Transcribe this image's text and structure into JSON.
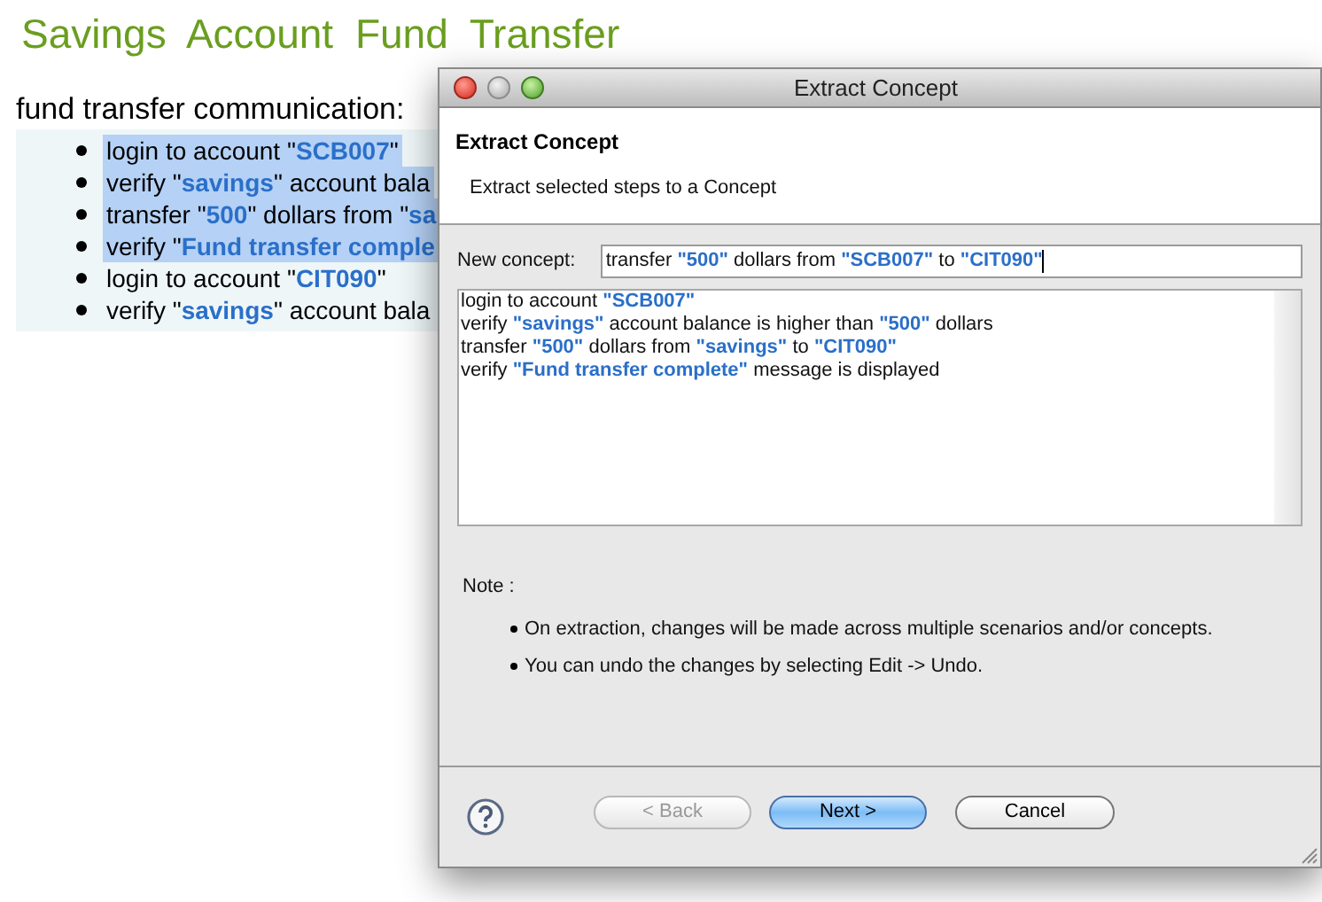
{
  "page": {
    "title": "Savings Account Fund Transfer",
    "section": "fund transfer communication:",
    "steps": [
      {
        "text": "login to account \"**SCB007**\"",
        "selected": true
      },
      {
        "text": "verify \"**savings**\" account bala",
        "selected": true
      },
      {
        "text": "transfer \"**500**\" dollars from \"**sa**",
        "selected": true
      },
      {
        "text": "verify \"**Fund transfer comple**",
        "selected": true
      },
      {
        "text": "login to account \"**CIT090**\"",
        "selected": false
      },
      {
        "text": "verify \"**savings**\" account bala",
        "selected": false
      }
    ]
  },
  "dialog": {
    "title": "Extract Concept",
    "heading": "Extract Concept",
    "description": "Extract selected steps to a Concept",
    "concept_label": "New concept:",
    "concept_value": "transfer **\"500\"** dollars from **\"SCB007\"** to **\"CIT090\"**",
    "steps": [
      "login to account **\"SCB007\"**",
      "verify **\"savings\"** account balance is higher than **\"500\"** dollars",
      "transfer **\"500\"** dollars from **\"savings\"** to **\"CIT090\"**",
      "verify **\"Fund transfer complete\"** message is displayed"
    ],
    "note_label": "Note :",
    "notes": [
      "On extraction, changes will be made across multiple scenarios and/or concepts.",
      "You can undo the changes by selecting Edit -> Undo."
    ],
    "buttons": [
      {
        "label": "< Back",
        "disabled": true,
        "default": false
      },
      {
        "label": "Next >",
        "disabled": false,
        "default": true
      },
      {
        "label": "Cancel",
        "disabled": false,
        "default": false
      }
    ]
  }
}
